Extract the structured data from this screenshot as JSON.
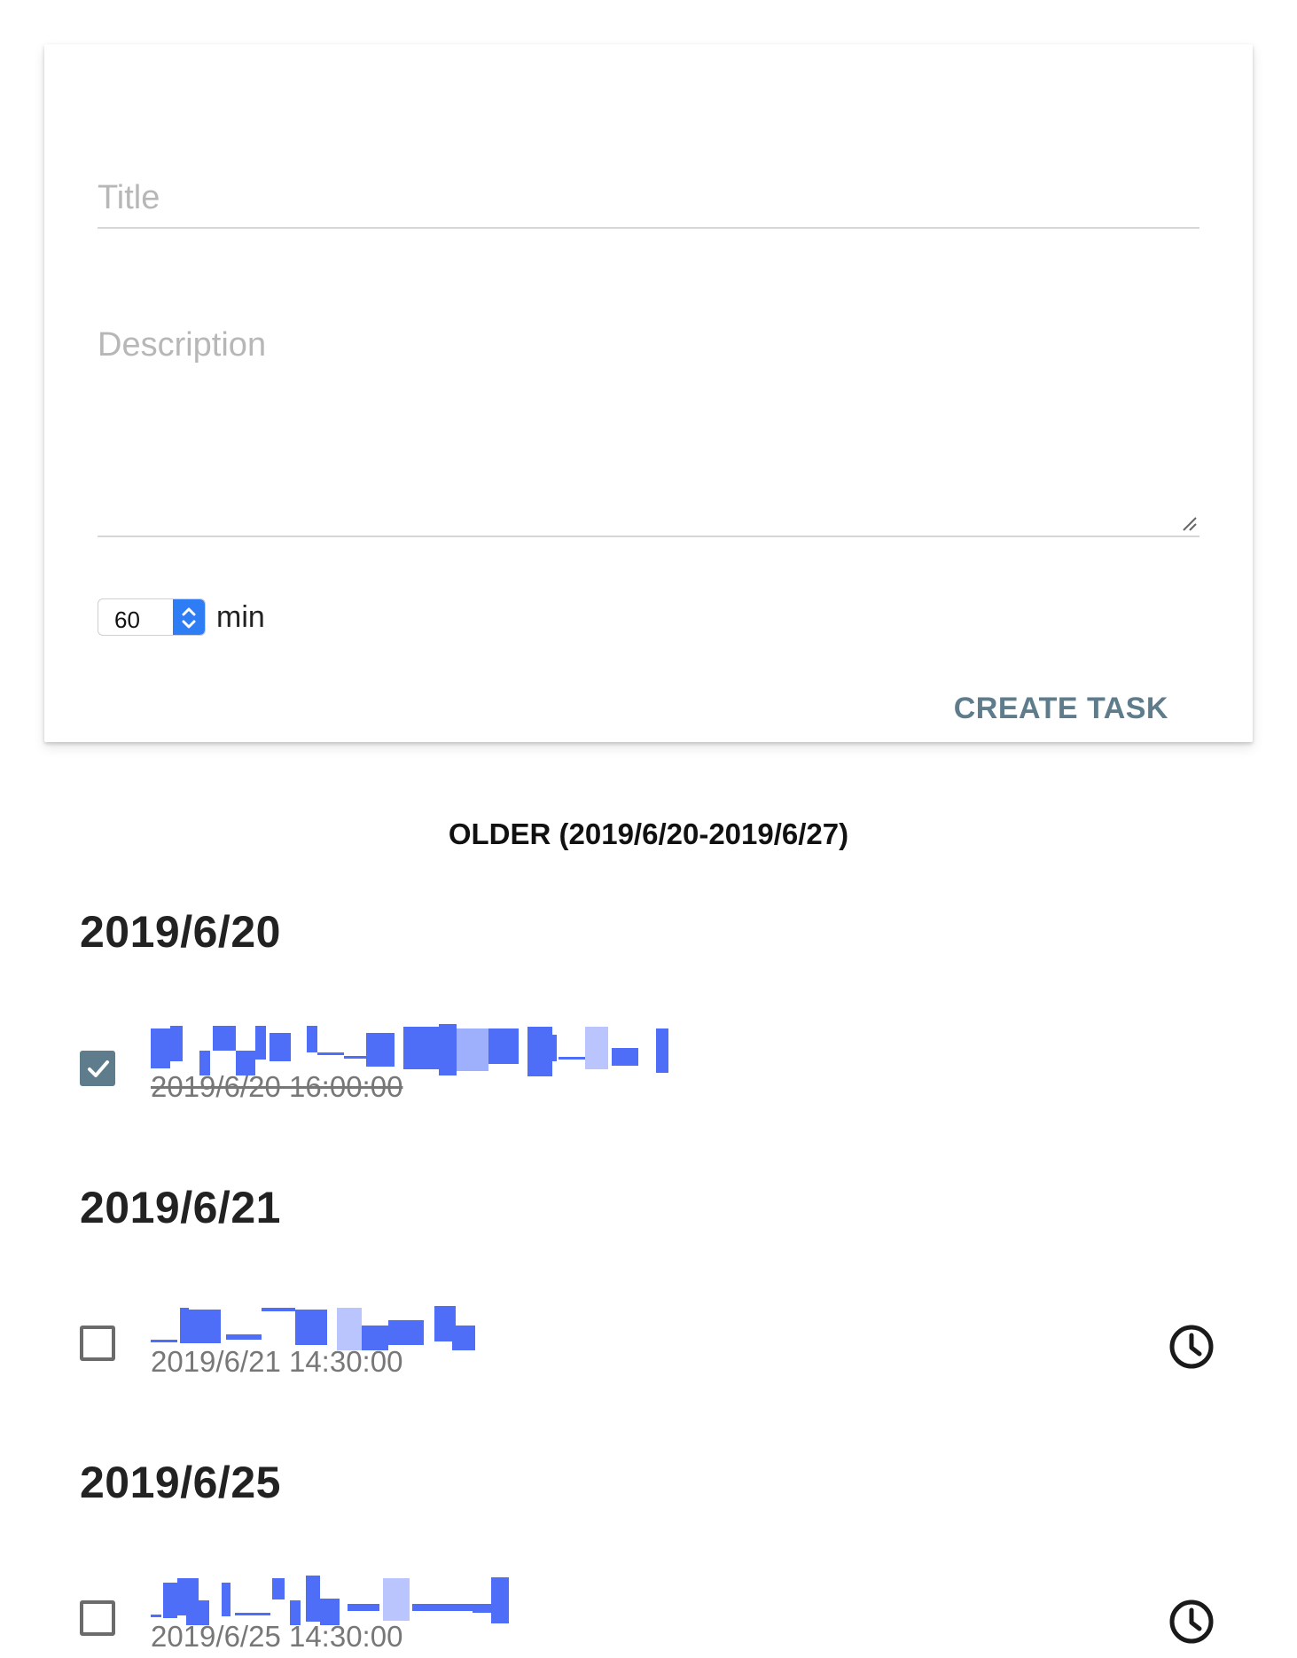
{
  "form": {
    "title_placeholder": "Title",
    "description_placeholder": "Description",
    "duration_value": "60",
    "duration_unit": "min",
    "create_label": "CREATE TASK"
  },
  "section": {
    "heading": "OLDER (2019/6/20-2019/6/27)"
  },
  "days": [
    {
      "date": "2019/6/20",
      "task": {
        "time": "2019/6/20 16:00:00",
        "completed": true,
        "title_redacted": true
      }
    },
    {
      "date": "2019/6/21",
      "task": {
        "time": "2019/6/21 14:30:00",
        "completed": false,
        "title_redacted": true
      }
    },
    {
      "date": "2019/6/25",
      "task": {
        "time": "2019/6/25 14:30:00",
        "completed": false,
        "title_redacted": true
      }
    }
  ],
  "colors": {
    "accent": "#5e7c8c",
    "redaction": "#4f6ef7",
    "stepper": "#2f7df5"
  },
  "icons": {
    "checked": "checkbox-checked-icon",
    "unchecked": "checkbox-empty-icon",
    "schedule": "clock-icon",
    "resize": "resize-handle-icon"
  }
}
